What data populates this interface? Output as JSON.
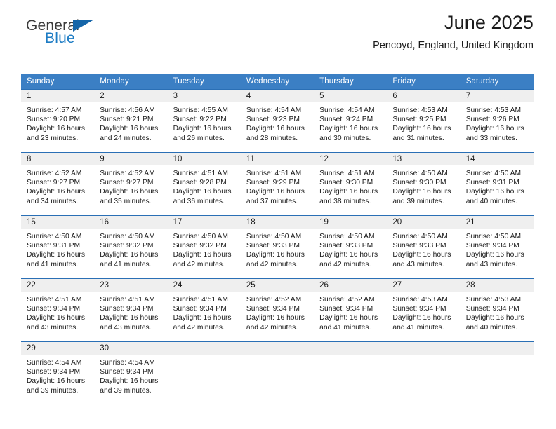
{
  "brand": {
    "name_part1": "General",
    "name_part2": "Blue",
    "flag_icon": "blue-flag-icon",
    "accent_color": "#1d7cc4"
  },
  "header": {
    "title": "June 2025",
    "subtitle": "Pencoyd, England, United Kingdom"
  },
  "calendar": {
    "header_bg": "#3b7fc4",
    "row_border_color": "#2a6fb5",
    "daynum_bg": "#efefef",
    "weekday_headers": [
      "Sunday",
      "Monday",
      "Tuesday",
      "Wednesday",
      "Thursday",
      "Friday",
      "Saturday"
    ],
    "weeks": [
      [
        {
          "day": "1",
          "sunrise": "Sunrise: 4:57 AM",
          "sunset": "Sunset: 9:20 PM",
          "daylight": "Daylight: 16 hours and 23 minutes."
        },
        {
          "day": "2",
          "sunrise": "Sunrise: 4:56 AM",
          "sunset": "Sunset: 9:21 PM",
          "daylight": "Daylight: 16 hours and 24 minutes."
        },
        {
          "day": "3",
          "sunrise": "Sunrise: 4:55 AM",
          "sunset": "Sunset: 9:22 PM",
          "daylight": "Daylight: 16 hours and 26 minutes."
        },
        {
          "day": "4",
          "sunrise": "Sunrise: 4:54 AM",
          "sunset": "Sunset: 9:23 PM",
          "daylight": "Daylight: 16 hours and 28 minutes."
        },
        {
          "day": "5",
          "sunrise": "Sunrise: 4:54 AM",
          "sunset": "Sunset: 9:24 PM",
          "daylight": "Daylight: 16 hours and 30 minutes."
        },
        {
          "day": "6",
          "sunrise": "Sunrise: 4:53 AM",
          "sunset": "Sunset: 9:25 PM",
          "daylight": "Daylight: 16 hours and 31 minutes."
        },
        {
          "day": "7",
          "sunrise": "Sunrise: 4:53 AM",
          "sunset": "Sunset: 9:26 PM",
          "daylight": "Daylight: 16 hours and 33 minutes."
        }
      ],
      [
        {
          "day": "8",
          "sunrise": "Sunrise: 4:52 AM",
          "sunset": "Sunset: 9:27 PM",
          "daylight": "Daylight: 16 hours and 34 minutes."
        },
        {
          "day": "9",
          "sunrise": "Sunrise: 4:52 AM",
          "sunset": "Sunset: 9:27 PM",
          "daylight": "Daylight: 16 hours and 35 minutes."
        },
        {
          "day": "10",
          "sunrise": "Sunrise: 4:51 AM",
          "sunset": "Sunset: 9:28 PM",
          "daylight": "Daylight: 16 hours and 36 minutes."
        },
        {
          "day": "11",
          "sunrise": "Sunrise: 4:51 AM",
          "sunset": "Sunset: 9:29 PM",
          "daylight": "Daylight: 16 hours and 37 minutes."
        },
        {
          "day": "12",
          "sunrise": "Sunrise: 4:51 AM",
          "sunset": "Sunset: 9:30 PM",
          "daylight": "Daylight: 16 hours and 38 minutes."
        },
        {
          "day": "13",
          "sunrise": "Sunrise: 4:50 AM",
          "sunset": "Sunset: 9:30 PM",
          "daylight": "Daylight: 16 hours and 39 minutes."
        },
        {
          "day": "14",
          "sunrise": "Sunrise: 4:50 AM",
          "sunset": "Sunset: 9:31 PM",
          "daylight": "Daylight: 16 hours and 40 minutes."
        }
      ],
      [
        {
          "day": "15",
          "sunrise": "Sunrise: 4:50 AM",
          "sunset": "Sunset: 9:31 PM",
          "daylight": "Daylight: 16 hours and 41 minutes."
        },
        {
          "day": "16",
          "sunrise": "Sunrise: 4:50 AM",
          "sunset": "Sunset: 9:32 PM",
          "daylight": "Daylight: 16 hours and 41 minutes."
        },
        {
          "day": "17",
          "sunrise": "Sunrise: 4:50 AM",
          "sunset": "Sunset: 9:32 PM",
          "daylight": "Daylight: 16 hours and 42 minutes."
        },
        {
          "day": "18",
          "sunrise": "Sunrise: 4:50 AM",
          "sunset": "Sunset: 9:33 PM",
          "daylight": "Daylight: 16 hours and 42 minutes."
        },
        {
          "day": "19",
          "sunrise": "Sunrise: 4:50 AM",
          "sunset": "Sunset: 9:33 PM",
          "daylight": "Daylight: 16 hours and 42 minutes."
        },
        {
          "day": "20",
          "sunrise": "Sunrise: 4:50 AM",
          "sunset": "Sunset: 9:33 PM",
          "daylight": "Daylight: 16 hours and 43 minutes."
        },
        {
          "day": "21",
          "sunrise": "Sunrise: 4:50 AM",
          "sunset": "Sunset: 9:34 PM",
          "daylight": "Daylight: 16 hours and 43 minutes."
        }
      ],
      [
        {
          "day": "22",
          "sunrise": "Sunrise: 4:51 AM",
          "sunset": "Sunset: 9:34 PM",
          "daylight": "Daylight: 16 hours and 43 minutes."
        },
        {
          "day": "23",
          "sunrise": "Sunrise: 4:51 AM",
          "sunset": "Sunset: 9:34 PM",
          "daylight": "Daylight: 16 hours and 43 minutes."
        },
        {
          "day": "24",
          "sunrise": "Sunrise: 4:51 AM",
          "sunset": "Sunset: 9:34 PM",
          "daylight": "Daylight: 16 hours and 42 minutes."
        },
        {
          "day": "25",
          "sunrise": "Sunrise: 4:52 AM",
          "sunset": "Sunset: 9:34 PM",
          "daylight": "Daylight: 16 hours and 42 minutes."
        },
        {
          "day": "26",
          "sunrise": "Sunrise: 4:52 AM",
          "sunset": "Sunset: 9:34 PM",
          "daylight": "Daylight: 16 hours and 41 minutes."
        },
        {
          "day": "27",
          "sunrise": "Sunrise: 4:53 AM",
          "sunset": "Sunset: 9:34 PM",
          "daylight": "Daylight: 16 hours and 41 minutes."
        },
        {
          "day": "28",
          "sunrise": "Sunrise: 4:53 AM",
          "sunset": "Sunset: 9:34 PM",
          "daylight": "Daylight: 16 hours and 40 minutes."
        }
      ],
      [
        {
          "day": "29",
          "sunrise": "Sunrise: 4:54 AM",
          "sunset": "Sunset: 9:34 PM",
          "daylight": "Daylight: 16 hours and 39 minutes."
        },
        {
          "day": "30",
          "sunrise": "Sunrise: 4:54 AM",
          "sunset": "Sunset: 9:34 PM",
          "daylight": "Daylight: 16 hours and 39 minutes."
        },
        {
          "day": "",
          "sunrise": "",
          "sunset": "",
          "daylight": ""
        },
        {
          "day": "",
          "sunrise": "",
          "sunset": "",
          "daylight": ""
        },
        {
          "day": "",
          "sunrise": "",
          "sunset": "",
          "daylight": ""
        },
        {
          "day": "",
          "sunrise": "",
          "sunset": "",
          "daylight": ""
        },
        {
          "day": "",
          "sunrise": "",
          "sunset": "",
          "daylight": ""
        }
      ]
    ]
  }
}
